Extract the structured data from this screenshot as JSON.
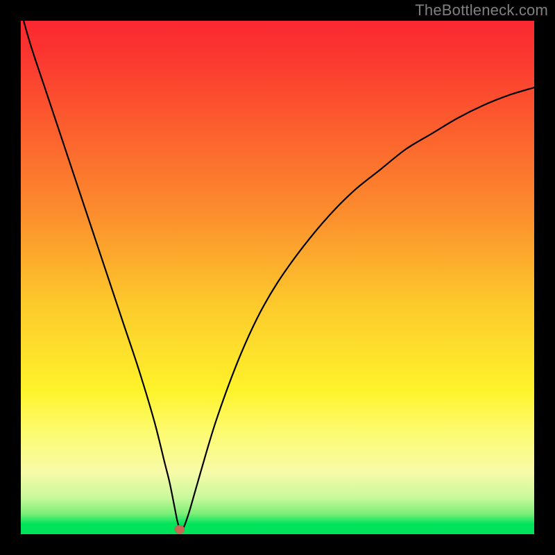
{
  "watermark": "TheBottleneck.com",
  "colors": {
    "page_bg": "#000000",
    "grad_top": "#fb2831",
    "grad_orange": "#fc8f2d",
    "grad_yellow": "#fef32b",
    "grad_pale": "#f7fba8",
    "grad_green": "#00e35b",
    "curve": "#000000",
    "marker": "#c76854",
    "watermark": "#808080"
  },
  "chart_data": {
    "type": "line",
    "title": "",
    "xlabel": "",
    "ylabel": "",
    "xlim": [
      0,
      100
    ],
    "ylim": [
      0,
      100
    ],
    "x": [
      0,
      2,
      5,
      8,
      11,
      14,
      17,
      20,
      23,
      26,
      28,
      29,
      30,
      30.5,
      31,
      31.5,
      32,
      33,
      35,
      38,
      42,
      46,
      50,
      55,
      60,
      65,
      70,
      75,
      80,
      85,
      90,
      95,
      100
    ],
    "y": [
      102,
      95,
      86,
      77,
      68,
      59,
      50,
      41,
      32,
      22,
      14,
      10,
      5,
      2.5,
      1,
      1,
      2,
      5,
      12,
      22,
      33,
      42,
      49,
      56,
      62,
      67,
      71,
      75,
      78,
      81,
      83.5,
      85.5,
      87
    ],
    "min_point": {
      "x": 31,
      "y": 1
    },
    "annotations": [],
    "legend": []
  }
}
